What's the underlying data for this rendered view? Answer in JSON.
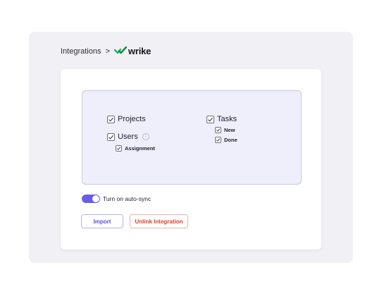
{
  "breadcrumb": {
    "parent": "Integrations",
    "separator": ">",
    "brand_name": "wrike",
    "brand_icon": "wrike-check-logo",
    "brand_color": "#1db954"
  },
  "scopes": {
    "projects": {
      "label": "Projects",
      "checked": true
    },
    "users": {
      "label": "Users",
      "checked": true,
      "info_icon": "info-icon",
      "children": [
        {
          "label": "Assignment",
          "checked": true
        }
      ]
    },
    "tasks": {
      "label": "Tasks",
      "checked": true,
      "children": [
        {
          "label": "New",
          "checked": true
        },
        {
          "label": "Done",
          "checked": true
        }
      ]
    }
  },
  "auto_sync": {
    "label": "Turn on auto-sync",
    "enabled": true,
    "accent": "#6b5ce7"
  },
  "actions": {
    "import_label": "Import",
    "unlink_label": "Unlink Integration"
  },
  "colors": {
    "panel_bg": "#f1f1f5",
    "scope_box_bg": "#efeefb",
    "import_text": "#5b4fd8",
    "unlink_text": "#d8402f"
  }
}
